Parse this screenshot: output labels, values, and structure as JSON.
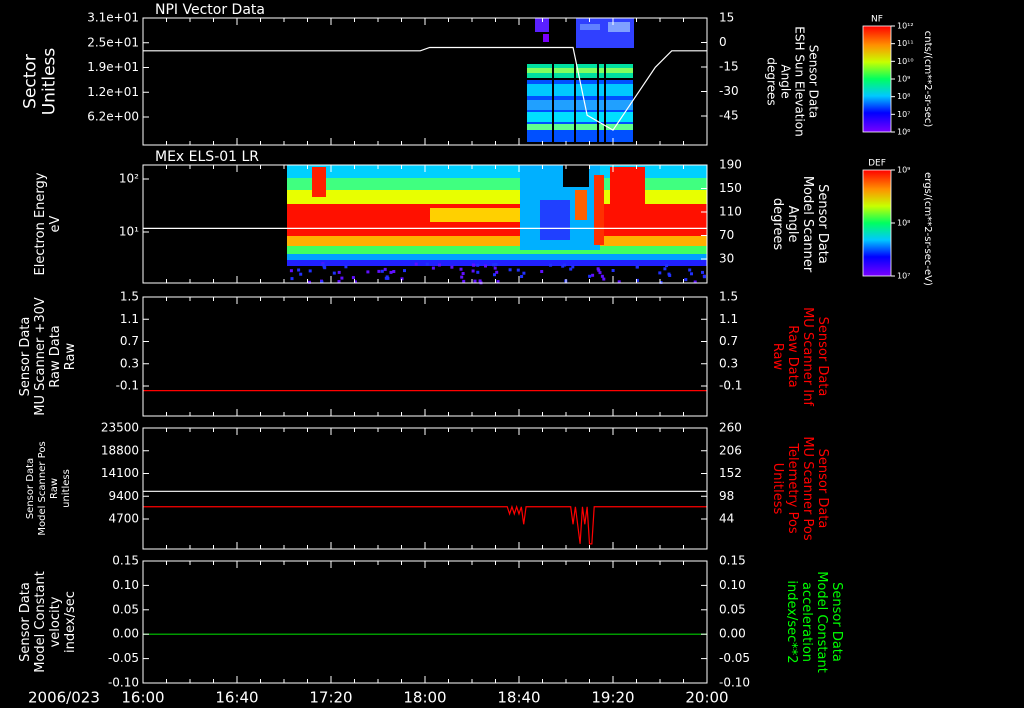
{
  "date_label": "2006/023",
  "x_ticks": [
    "16:00",
    "16:40",
    "17:20",
    "18:00",
    "18:40",
    "19:20",
    "20:00"
  ],
  "colors": {
    "background": "#000000",
    "axis": "#ffffff",
    "red_axis_label": "#ff0000",
    "green_axis_label": "#00ff00",
    "trace_white": "#ffffff",
    "trace_red": "#ff0000",
    "trace_green": "#00cc00"
  },
  "colorbars": [
    {
      "tag": "NF",
      "ticks": [
        "10¹²",
        "10¹¹",
        "10¹⁰",
        "10⁹",
        "10⁸",
        "10⁷",
        "10⁶"
      ],
      "unit_label": "cnts/(cm**2-sr-sec)"
    },
    {
      "tag": "DEF",
      "ticks": [
        "10⁹",
        "10⁸",
        "10⁷"
      ],
      "unit_label": "ergs/(cm**2-sr-sec-eV)"
    }
  ],
  "chart_data": [
    {
      "type": "heatmap",
      "title": "NPI Vector Data",
      "ylabel": [
        "Sector",
        "Unitless"
      ],
      "y_ticks": [
        "3.1e+01",
        "2.5e+01",
        "1.9e+01",
        "1.2e+01",
        "6.2e+00"
      ],
      "right_ylabel": [
        "Sensor Data",
        "ESH Sun Elevation",
        "Angle",
        "degrees"
      ],
      "right_ticks": [
        "15",
        "0",
        "-15",
        "-30",
        "-45"
      ],
      "right_ylim": [
        -57,
        15
      ],
      "overlay_line": {
        "x": [
          "16:00",
          "17:58",
          "18:02",
          "19:03",
          "19:09",
          "19:20",
          "19:38",
          "19:45",
          "20:00"
        ],
        "y": [
          0,
          0,
          2,
          2,
          -39,
          -48,
          -10,
          0,
          0
        ]
      }
    },
    {
      "type": "heatmap",
      "title": "MEx ELS-01 LR",
      "ylabel": [
        "Electron Energy",
        "eV"
      ],
      "y_ticks": [
        "10²",
        "10¹"
      ],
      "right_ylabel": [
        "Sensor Data",
        "Model Scanner",
        "Angle",
        "degrees"
      ],
      "right_ticks": [
        "190",
        "150",
        "110",
        "70",
        "30"
      ],
      "right_ylim": [
        0,
        190
      ],
      "overlay_line": {
        "x": [
          "16:00",
          "20:00"
        ],
        "y": [
          88,
          88
        ]
      }
    },
    {
      "type": "line",
      "ylabel": [
        "Sensor Data",
        "MU Scanner +30V",
        "Raw Data",
        "Raw"
      ],
      "y_ticks": [
        "1.5",
        "1.1",
        "0.7",
        "0.3",
        "-0.1"
      ],
      "ylim": [
        -0.5,
        1.5
      ],
      "right_ylabel": [
        "Sensor Data",
        "MU Scanner Inf",
        "Raw Data",
        "Raw"
      ],
      "right_ticks": [
        "1.5",
        "1.1",
        "0.7",
        "0.3",
        "-0.1"
      ],
      "series": [
        {
          "x": [
            "16:00",
            "20:00"
          ],
          "y": [
            -0.1,
            -0.1
          ]
        }
      ]
    },
    {
      "type": "line",
      "ylabel": [
        "Sensor Data",
        "Model Scanner Pos",
        "Raw",
        "unitless"
      ],
      "y_ticks": [
        "23500",
        "18800",
        "14100",
        "9400",
        "4700"
      ],
      "ylim": [
        0,
        23500
      ],
      "right_ylabel": [
        "Sensor Data",
        "MU Scanner Pos",
        "Telemetry Pos",
        "Unitless"
      ],
      "right_ticks": [
        "260",
        "206",
        "152",
        "98",
        "44"
      ],
      "right_ylim": [
        0,
        260
      ],
      "series": [
        {
          "x": [
            "16:00",
            "20:00"
          ],
          "y": [
            11200,
            11200
          ]
        },
        {
          "x": [
            "16:00",
            "18:35",
            "18:36",
            "18:37",
            "18:38",
            "18:39",
            "18:40",
            "18:41",
            "18:42",
            "18:43",
            "19:02",
            "19:03",
            "19:04",
            "19:06",
            "19:07",
            "19:08",
            "19:09",
            "19:10",
            "19:11",
            "19:12",
            "19:14",
            "20:00"
          ],
          "y": [
            8200,
            8200,
            6800,
            8200,
            6800,
            8200,
            6800,
            8200,
            4800,
            8200,
            8200,
            4800,
            8200,
            1000,
            8200,
            4800,
            8200,
            1000,
            1000,
            8200,
            8200,
            8200
          ]
        }
      ]
    },
    {
      "type": "line",
      "ylabel": [
        "Sensor Data",
        "Model Constant",
        "velocity",
        "index/sec"
      ],
      "y_ticks": [
        "0.15",
        "0.10",
        "0.05",
        "0.00",
        "-0.05",
        "-0.10"
      ],
      "ylim": [
        -0.1,
        0.15
      ],
      "right_ylabel": [
        "Sensor Data",
        "Model Constant",
        "acceleration",
        "index/sec**2"
      ],
      "right_ticks": [
        "0.15",
        "0.10",
        "0.05",
        "0.00",
        "-0.05",
        "-0.10"
      ],
      "series": [
        {
          "x": [
            "16:00",
            "20:00"
          ],
          "y": [
            0,
            0
          ]
        }
      ]
    }
  ]
}
